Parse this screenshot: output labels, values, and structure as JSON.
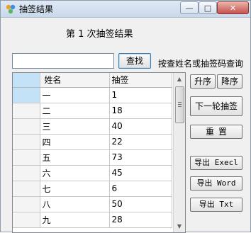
{
  "window": {
    "title": "抽签结果",
    "minimize_glyph": "—",
    "maximize_glyph": "□",
    "close_glyph": "✕",
    "icon": "app-logo-icon"
  },
  "heading": "第 1 次抽签结果",
  "search": {
    "value": "",
    "placeholder": "",
    "button_label": "查找",
    "hint": "按查姓名或抽签码查询"
  },
  "buttons": {
    "asc": "升序",
    "desc": "降序",
    "next_round": "下一轮抽签",
    "reset": "重置",
    "export_excel": "导出 Execl",
    "export_word": "导出 Word",
    "export_txt": "导出 Txt"
  },
  "table": {
    "columns": [
      "",
      "姓名",
      "抽签"
    ],
    "rows": [
      {
        "name": "一",
        "draw": "1"
      },
      {
        "name": "二",
        "draw": "18"
      },
      {
        "name": "三",
        "draw": "40"
      },
      {
        "name": "四",
        "draw": "22"
      },
      {
        "name": "五",
        "draw": "73"
      },
      {
        "name": "六",
        "draw": "45"
      },
      {
        "name": "七",
        "draw": "6"
      },
      {
        "name": "八",
        "draw": "50"
      },
      {
        "name": "九",
        "draw": "28"
      }
    ]
  },
  "scrollbar": {
    "up_glyph": "▲",
    "down_glyph": "▼"
  }
}
